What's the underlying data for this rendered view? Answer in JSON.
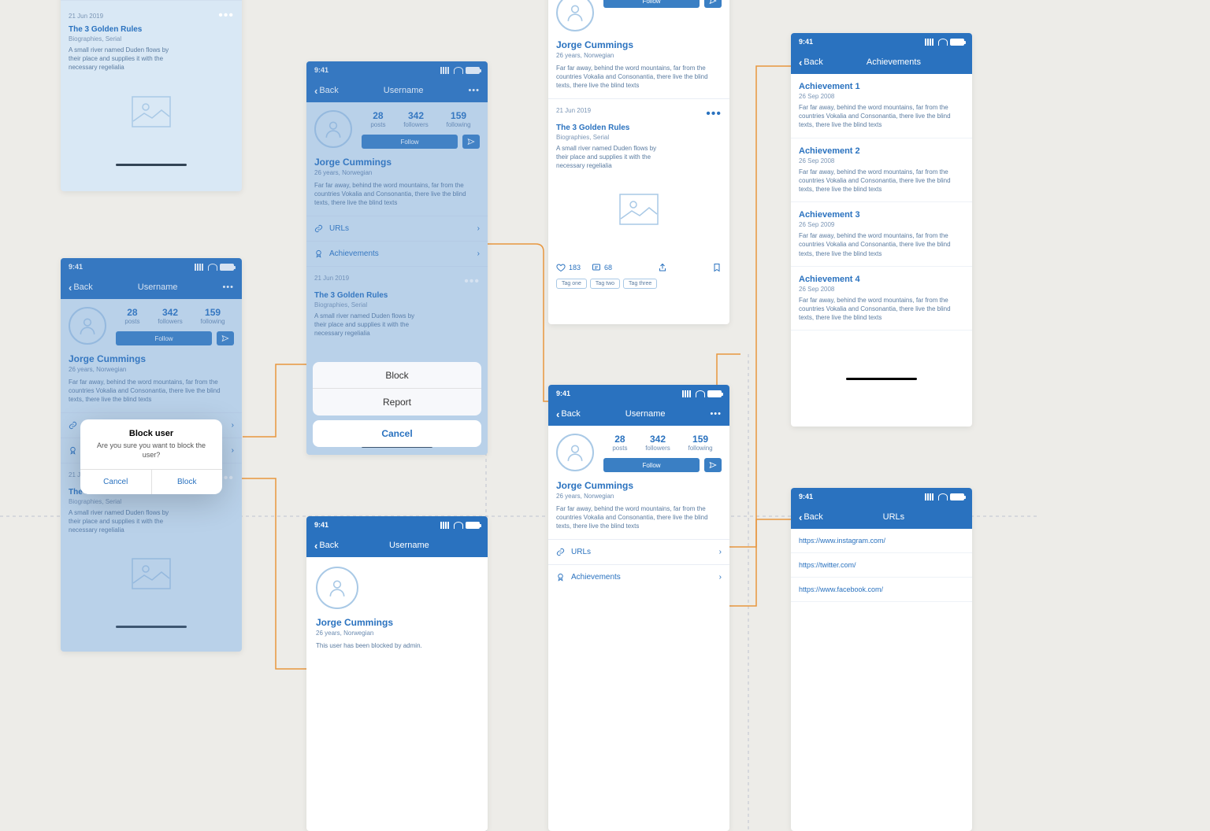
{
  "time": "9:41",
  "back": "Back",
  "nav_user": "Username",
  "nav_ach": "Achievements",
  "nav_urls": "URLs",
  "profile": {
    "name": "Jorge Cummings",
    "meta": "26 years, Norwegian",
    "bio": "Far far away, behind the word mountains, far from the countries Vokalia and Consonantia, there live the blind texts, there live the blind texts",
    "blocked": "This user has been blocked by admin."
  },
  "stats": {
    "posts": "28",
    "posts_l": "posts",
    "followers": "342",
    "followers_l": "followers",
    "following": "159",
    "following_l": "following"
  },
  "follow": "Follow",
  "links": {
    "urls": "URLs",
    "ach": "Achievements"
  },
  "post": {
    "date": "21 Jun 2019",
    "title": "The 3 Golden Rules",
    "cat": "Biographies, Serial",
    "desc": "A small river named Duden flows by their place and supplies it with the necessary regelialia"
  },
  "engage": {
    "likes": "183",
    "comments": "68"
  },
  "tags": {
    "t1": "Tag one",
    "t2": "Tag two",
    "t3": "Tag three"
  },
  "sheet": {
    "block": "Block",
    "report": "Report",
    "cancel": "Cancel"
  },
  "modal": {
    "title": "Block user",
    "msg": "Are you sure you want to block the user?",
    "cancel": "Cancel",
    "block": "Block"
  },
  "ach_desc": "Far far away, behind the word mountains, far from the countries Vokalia and Consonantia, there live the blind texts, there live the blind texts",
  "ach": {
    "a1": {
      "t": "Achievement 1",
      "d": "26 Sep 2008"
    },
    "a2": {
      "t": "Achievement 2",
      "d": "26 Sep 2008"
    },
    "a3": {
      "t": "Achievement 3",
      "d": "26 Sep 2009"
    },
    "a4": {
      "t": "Achievement 4",
      "d": "26 Sep 2008"
    }
  },
  "urls": {
    "u1": "https://www.instagram.com/",
    "u2": "https://twitter.com/",
    "u3": "https://www.facebook.com/"
  }
}
